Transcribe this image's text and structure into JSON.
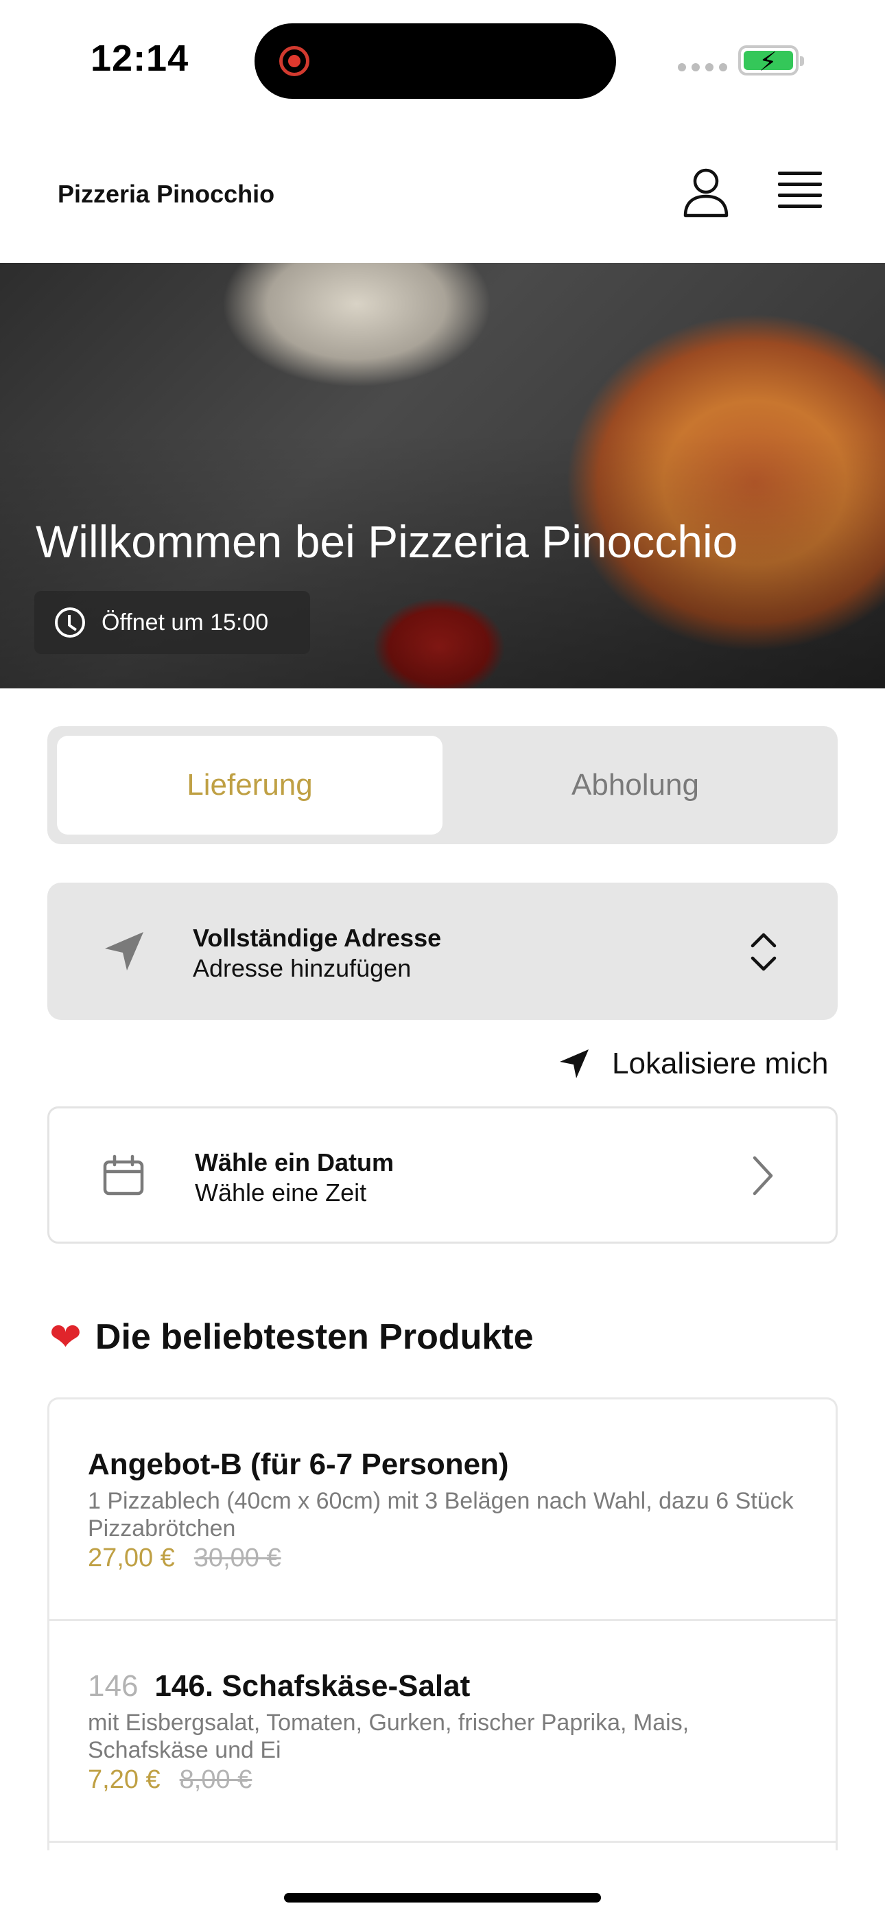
{
  "status_bar": {
    "time": "12:14"
  },
  "header": {
    "brand": "Pizzeria Pinocchio"
  },
  "hero": {
    "title": "Willkommen bei Pizzeria Pinocchio",
    "opening": "Öffnet um 15:00"
  },
  "order_mode": {
    "options": [
      "Lieferung",
      "Abholung"
    ],
    "selected": "Lieferung"
  },
  "address": {
    "title": "Vollständige Adresse",
    "subtitle": "Adresse hinzufügen"
  },
  "locate": {
    "label": "Lokalisiere mich"
  },
  "schedule": {
    "title": "Wähle ein Datum",
    "subtitle": "Wähle eine Zeit"
  },
  "popular": {
    "heading": "Die beliebtesten Produkte",
    "heading_icon": "heart-icon",
    "products": [
      {
        "number": "",
        "name": "Angebot-B (für 6-7 Personen)",
        "description": "1 Pizzablech (40cm x 60cm) mit 3 Belägen nach Wahl, dazu 6 Stück Pizzabrötchen",
        "price": "27,00 €",
        "old_price": "30,00 €"
      },
      {
        "number": "146",
        "name": "146. Schafskäse-Salat",
        "description": "mit Eisbergsalat, Tomaten, Gurken, frischer Paprika, Mais, Schafskäse und Ei",
        "price": "7,20 €",
        "old_price": "8,00 €"
      }
    ]
  },
  "colors": {
    "accent": "#bfa044",
    "panel": "#e6e6e6",
    "battery": "#34c759"
  }
}
